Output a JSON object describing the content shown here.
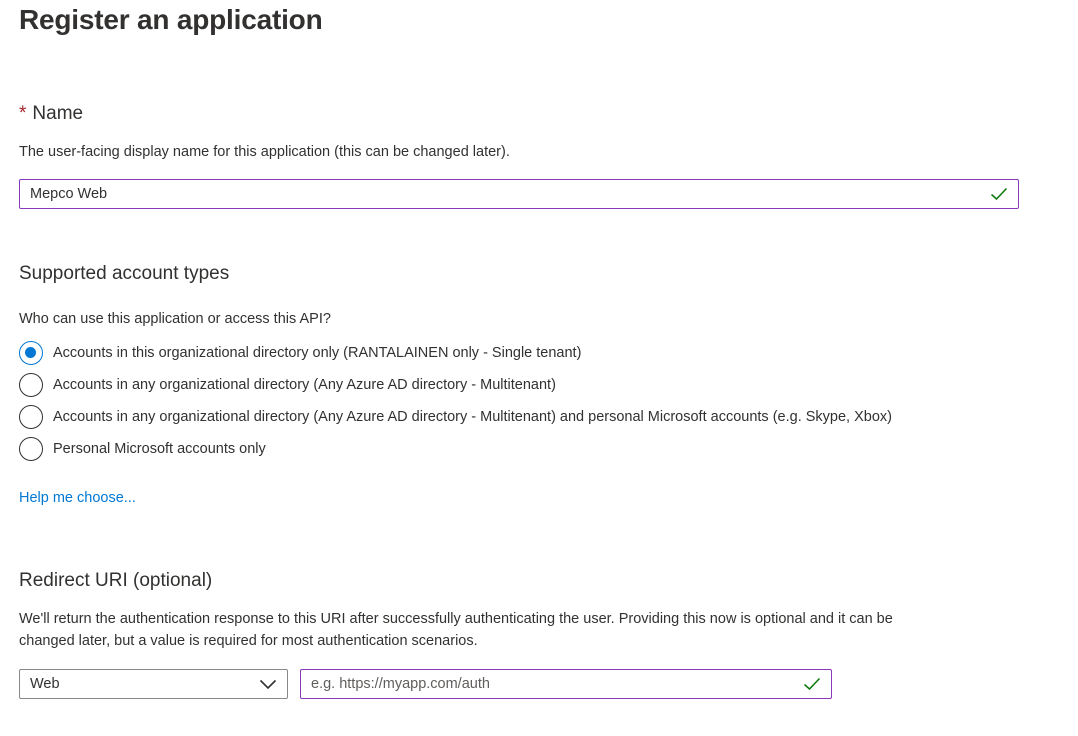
{
  "page": {
    "title": "Register an application"
  },
  "name_section": {
    "required_marker": "*",
    "label": "Name",
    "description": "The user-facing display name for this application (this can be changed later).",
    "input_value": "Mepco Web"
  },
  "account_types": {
    "label": "Supported account types",
    "question": "Who can use this application or access this API?",
    "options": [
      {
        "label": "Accounts in this organizational directory only (RANTALAINEN only - Single tenant)",
        "selected": true
      },
      {
        "label": "Accounts in any organizational directory (Any Azure AD directory - Multitenant)",
        "selected": false
      },
      {
        "label": "Accounts in any organizational directory (Any Azure AD directory - Multitenant) and personal Microsoft accounts (e.g. Skype, Xbox)",
        "selected": false
      },
      {
        "label": "Personal Microsoft accounts only",
        "selected": false
      }
    ],
    "help_link": "Help me choose..."
  },
  "redirect": {
    "label": "Redirect URI (optional)",
    "description_line1": "We'll return the authentication response to this URI after successfully authenticating the user. Providing this now is optional and it can be",
    "description_line2": "changed later, but a value is required for most authentication scenarios.",
    "platform_selected": "Web",
    "uri_placeholder": "e.g. https://myapp.com/auth"
  },
  "colors": {
    "accent": "#0078d4",
    "valid_check": "#107c10",
    "focus_border": "#8a3ab9",
    "required": "#a4262c"
  },
  "icons": {
    "valid": "checkmark-icon",
    "dropdown": "chevron-down-icon"
  }
}
